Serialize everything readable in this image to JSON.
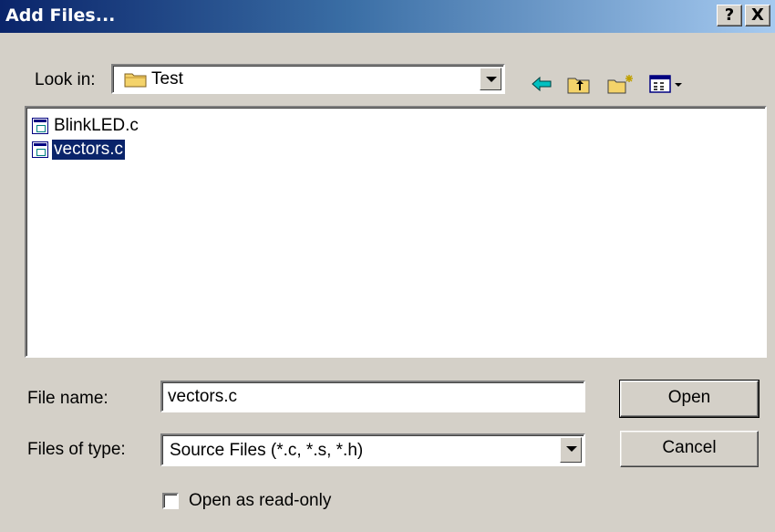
{
  "window": {
    "title": "Add Files...",
    "help_label": "?",
    "close_label": "X"
  },
  "look_in": {
    "label": "Look in:",
    "value": "Test",
    "folder_icon": "folder-icon"
  },
  "toolbar": {
    "back_icon": "back-arrow-icon",
    "up_icon": "up-folder-icon",
    "new_folder_icon": "new-folder-icon",
    "view_icon": "view-menu-icon"
  },
  "files": [
    {
      "name": "BlinkLED.c",
      "selected": false
    },
    {
      "name": "vectors.c",
      "selected": true
    }
  ],
  "file_name": {
    "label": "File name:",
    "value": "vectors.c"
  },
  "file_type": {
    "label": "Files of type:",
    "value": "Source Files (*.c, *.s, *.h)"
  },
  "buttons": {
    "open": "Open",
    "cancel": "Cancel"
  },
  "readonly": {
    "label": "Open as read-only",
    "checked": false
  }
}
